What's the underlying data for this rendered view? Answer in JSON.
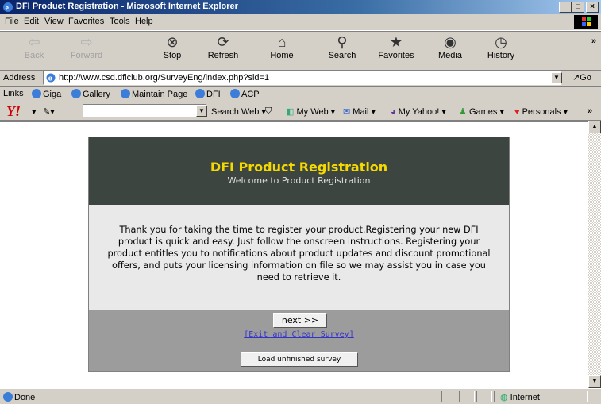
{
  "window": {
    "title": "DFI Product Registration - Microsoft Internet Explorer"
  },
  "menu": [
    "File",
    "Edit",
    "View",
    "Favorites",
    "Tools",
    "Help"
  ],
  "toolbar": [
    {
      "label": "Back",
      "icon": "back-arrow-icon",
      "enabled": false
    },
    {
      "label": "Forward",
      "icon": "forward-arrow-icon",
      "enabled": false
    },
    {
      "label": "Stop",
      "icon": "stop-icon",
      "enabled": true
    },
    {
      "label": "Refresh",
      "icon": "refresh-icon",
      "enabled": true
    },
    {
      "label": "Home",
      "icon": "home-icon",
      "enabled": true
    },
    {
      "label": "Search",
      "icon": "search-icon",
      "enabled": true
    },
    {
      "label": "Favorites",
      "icon": "favorites-icon",
      "enabled": true
    },
    {
      "label": "Media",
      "icon": "media-icon",
      "enabled": true
    },
    {
      "label": "History",
      "icon": "history-icon",
      "enabled": true
    }
  ],
  "address": {
    "label": "Address",
    "url": "http://www.csd.dficlub.org/SurveyEng/index.php?sid=1",
    "go_label": "Go"
  },
  "links": {
    "label": "Links",
    "items": [
      "Giga",
      "Gallery",
      "Maintain Page",
      "DFI",
      "ACP"
    ]
  },
  "yahoo": {
    "search_label": "Search Web",
    "items": [
      "My Web",
      "Mail",
      "My Yahoo!",
      "Games",
      "Personals"
    ]
  },
  "page": {
    "title": "DFI Product Registration",
    "subtitle": "Welcome to Product Registration",
    "body": "Thank you for taking the time to register your product.Registering your new DFI product is quick and easy. Just follow the onscreen instructions. Registering your product entitles you to notifications about product updates and discount promotional offers, and puts your licensing information on file so we may assist you in case you need to retrieve it.",
    "next_label": "next >>",
    "exit_label": "[Exit and Clear Survey]",
    "load_label": "Load unfinished survey"
  },
  "status": {
    "text": "Done",
    "zone": "Internet"
  },
  "colors": {
    "header_bg": "#3c4540",
    "title_color": "#f5d800",
    "link_color": "#3333cc"
  }
}
